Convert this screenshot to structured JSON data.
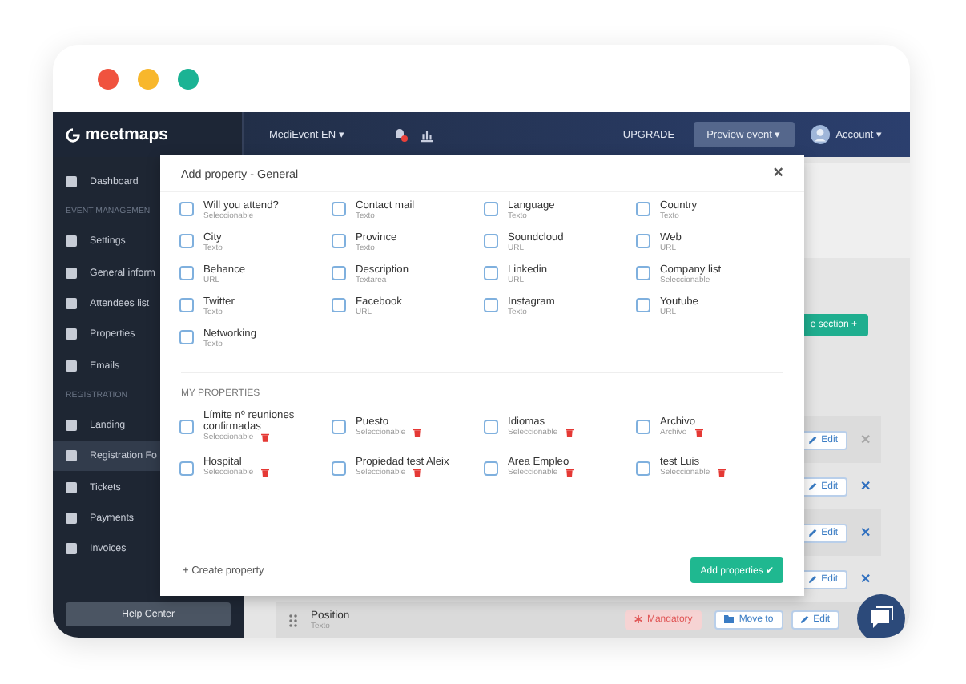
{
  "window": {
    "dots": [
      {
        "color": "#f0533f"
      },
      {
        "color": "#f8b72c"
      },
      {
        "color": "#1bb394"
      }
    ]
  },
  "topbar": {
    "logo": "meetmaps",
    "event": "MediEvent EN ▾",
    "upgrade": "UPGRADE",
    "preview": "Preview event ▾",
    "account": "Account ▾"
  },
  "sidebar": {
    "items": [
      {
        "kind": "item",
        "label": "Dashboard",
        "selected": false
      },
      {
        "kind": "header",
        "label": "EVENT MANAGEMEN"
      },
      {
        "kind": "item",
        "label": "Settings",
        "selected": false
      },
      {
        "kind": "item",
        "label": "General inform",
        "selected": false
      },
      {
        "kind": "item",
        "label": "Attendees list",
        "selected": false
      },
      {
        "kind": "item",
        "label": "Properties",
        "selected": false
      },
      {
        "kind": "item",
        "label": "Emails",
        "selected": false
      },
      {
        "kind": "header",
        "label": "REGISTRATION"
      },
      {
        "kind": "item",
        "label": "Landing",
        "selected": false
      },
      {
        "kind": "item",
        "label": "Registration Fo",
        "selected": true
      },
      {
        "kind": "item",
        "label": "Tickets",
        "selected": false
      },
      {
        "kind": "item",
        "label": "Payments",
        "selected": false
      },
      {
        "kind": "item",
        "label": "Invoices",
        "selected": false
      }
    ],
    "help": "Help Center"
  },
  "main": {
    "section_button": "e section +",
    "rows": [
      {
        "edit": "Edit",
        "remove": "✕",
        "disabled": true
      },
      {
        "edit": "Edit",
        "remove": "✕",
        "disabled": false
      },
      {
        "edit": "Edit",
        "remove": "✕",
        "disabled": false
      },
      {
        "edit": "Edit",
        "remove": "✕",
        "disabled": false
      }
    ],
    "bottom_row": {
      "name": "Position",
      "type": "Texto",
      "mandatory": "Mandatory",
      "move": "Move to",
      "edit": "Edit"
    }
  },
  "modal": {
    "title": "Add property - General",
    "close": "×",
    "general": [
      {
        "name": "Will you attend?",
        "type": "Seleccionable",
        "checked": false
      },
      {
        "name": "Contact mail",
        "type": "Texto",
        "checked": false
      },
      {
        "name": "Language",
        "type": "Texto",
        "checked": false
      },
      {
        "name": "Country",
        "type": "Texto",
        "checked": false
      },
      {
        "name": "City",
        "type": "Texto",
        "checked": false
      },
      {
        "name": "Province",
        "type": "Texto",
        "checked": false
      },
      {
        "name": "Soundcloud",
        "type": "URL",
        "checked": false
      },
      {
        "name": "Web",
        "type": "URL",
        "checked": false
      },
      {
        "name": "Behance",
        "type": "URL",
        "checked": false
      },
      {
        "name": "Description",
        "type": "Textarea",
        "checked": false
      },
      {
        "name": "Linkedin",
        "type": "URL",
        "checked": false
      },
      {
        "name": "Company list",
        "type": "Seleccionable",
        "checked": false
      },
      {
        "name": "Twitter",
        "type": "Texto",
        "checked": false
      },
      {
        "name": "Facebook",
        "type": "URL",
        "checked": false
      },
      {
        "name": "Instagram",
        "type": "Texto",
        "checked": false
      },
      {
        "name": "Youtube",
        "type": "URL",
        "checked": false
      },
      {
        "name": "Networking",
        "type": "Texto",
        "checked": false
      }
    ],
    "my_heading": "MY PROPERTIES",
    "mine": [
      {
        "name": "Límite nº reuniones confirmadas",
        "type": "Seleccionable",
        "checked": false
      },
      {
        "name": "Puesto",
        "type": "Seleccionable",
        "checked": false
      },
      {
        "name": "Idiomas",
        "type": "Seleccionable",
        "checked": false
      },
      {
        "name": "Archivo",
        "type": "Archivo",
        "checked": false
      },
      {
        "name": "Hospital",
        "type": "Seleccionable",
        "checked": false
      },
      {
        "name": "Propiedad test Aleix",
        "type": "Seleccionable",
        "checked": false
      },
      {
        "name": "Area Empleo",
        "type": "Seleccionable",
        "checked": false
      },
      {
        "name": "test Luis",
        "type": "Seleccionable",
        "checked": false
      }
    ],
    "create": "+ Create property",
    "add": "Add properties ✔"
  }
}
